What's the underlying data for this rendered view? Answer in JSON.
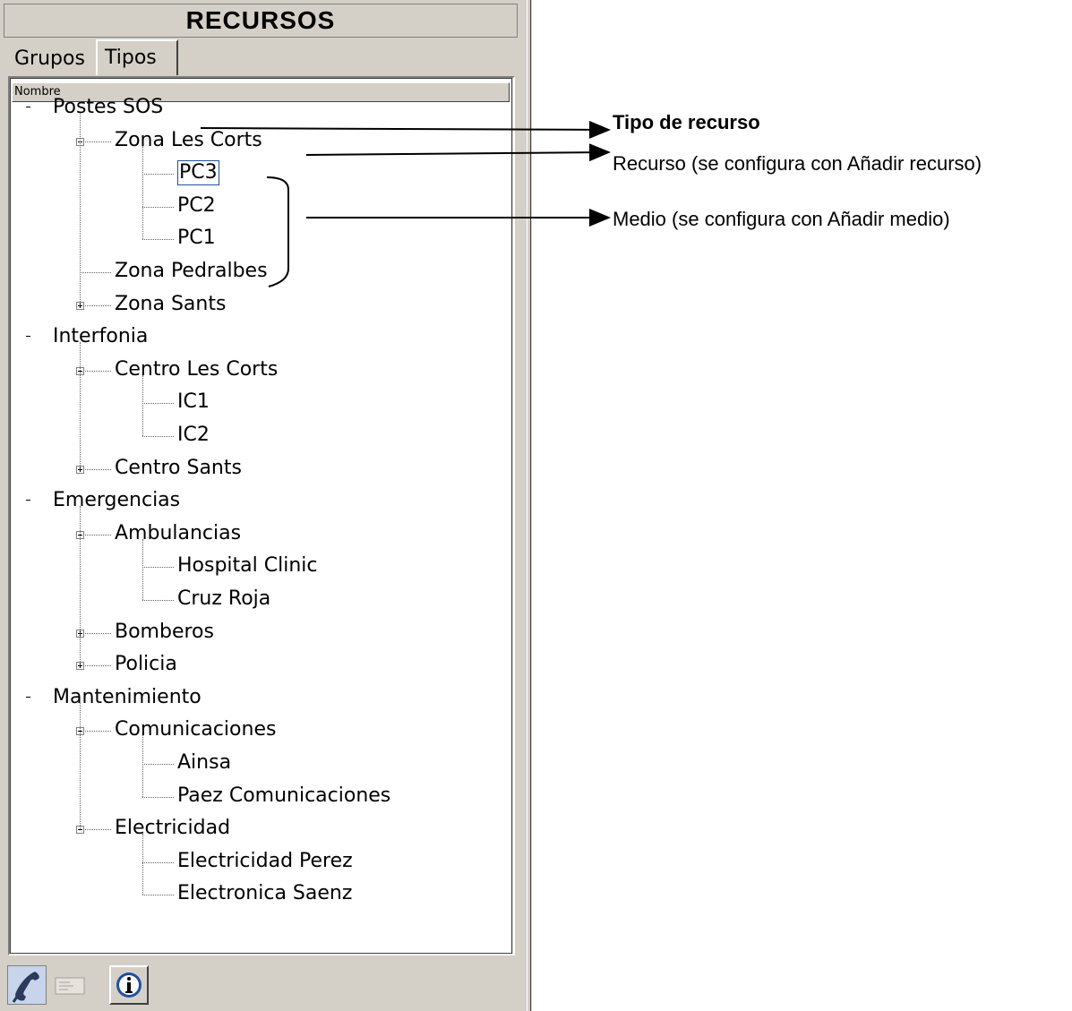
{
  "panel": {
    "title": "RECURSOS",
    "tabs": [
      {
        "label": "Grupos",
        "active": false
      },
      {
        "label": "Tipos",
        "active": true
      }
    ],
    "column_header": "Nombre"
  },
  "tree": [
    {
      "label": "Postes SOS",
      "level": 0,
      "expander": "minus"
    },
    {
      "label": "Zona Les Corts",
      "level": 1,
      "expander": "minus"
    },
    {
      "label": "PC3",
      "level": 2,
      "selected": true
    },
    {
      "label": "PC2",
      "level": 2
    },
    {
      "label": "PC1",
      "level": 2
    },
    {
      "label": "Zona Pedralbes",
      "level": 1
    },
    {
      "label": "Zona Sants",
      "level": 1,
      "expander": "plus"
    },
    {
      "label": "Interfonia",
      "level": 0,
      "expander": "minus"
    },
    {
      "label": "Centro Les Corts",
      "level": 1,
      "expander": "minus"
    },
    {
      "label": "IC1",
      "level": 2
    },
    {
      "label": "IC2",
      "level": 2
    },
    {
      "label": "Centro Sants",
      "level": 1,
      "expander": "plus"
    },
    {
      "label": "Emergencias",
      "level": 0,
      "expander": "minus"
    },
    {
      "label": "Ambulancias",
      "level": 1,
      "expander": "minus"
    },
    {
      "label": "Hospital Clinic",
      "level": 2
    },
    {
      "label": "Cruz Roja",
      "level": 2
    },
    {
      "label": "Bomberos",
      "level": 1,
      "expander": "plus"
    },
    {
      "label": "Policia",
      "level": 1,
      "expander": "plus"
    },
    {
      "label": "Mantenimiento",
      "level": 0,
      "expander": "minus"
    },
    {
      "label": "Comunicaciones",
      "level": 1,
      "expander": "minus"
    },
    {
      "label": "Ainsa",
      "level": 2
    },
    {
      "label": "Paez Comunicaciones",
      "level": 2
    },
    {
      "label": "Electricidad",
      "level": 1,
      "expander": "minus"
    },
    {
      "label": "Electricidad Perez",
      "level": 2
    },
    {
      "label": "Electronica Saenz",
      "level": 2
    }
  ],
  "toolbar": {
    "buttons": [
      {
        "icon": "phone-icon"
      },
      {
        "icon": "card-icon"
      },
      {
        "icon": "info-icon"
      }
    ]
  },
  "annotations": {
    "tipo": "Tipo de recurso",
    "recurso": "Recurso (se configura con Añadir recurso)",
    "medio": "Medio (se configura con Añadir medio)"
  },
  "colors": {
    "panel_bg": "#d4d0c8",
    "selection_border": "#2050a0",
    "info_blue": "#1f4fa0"
  }
}
